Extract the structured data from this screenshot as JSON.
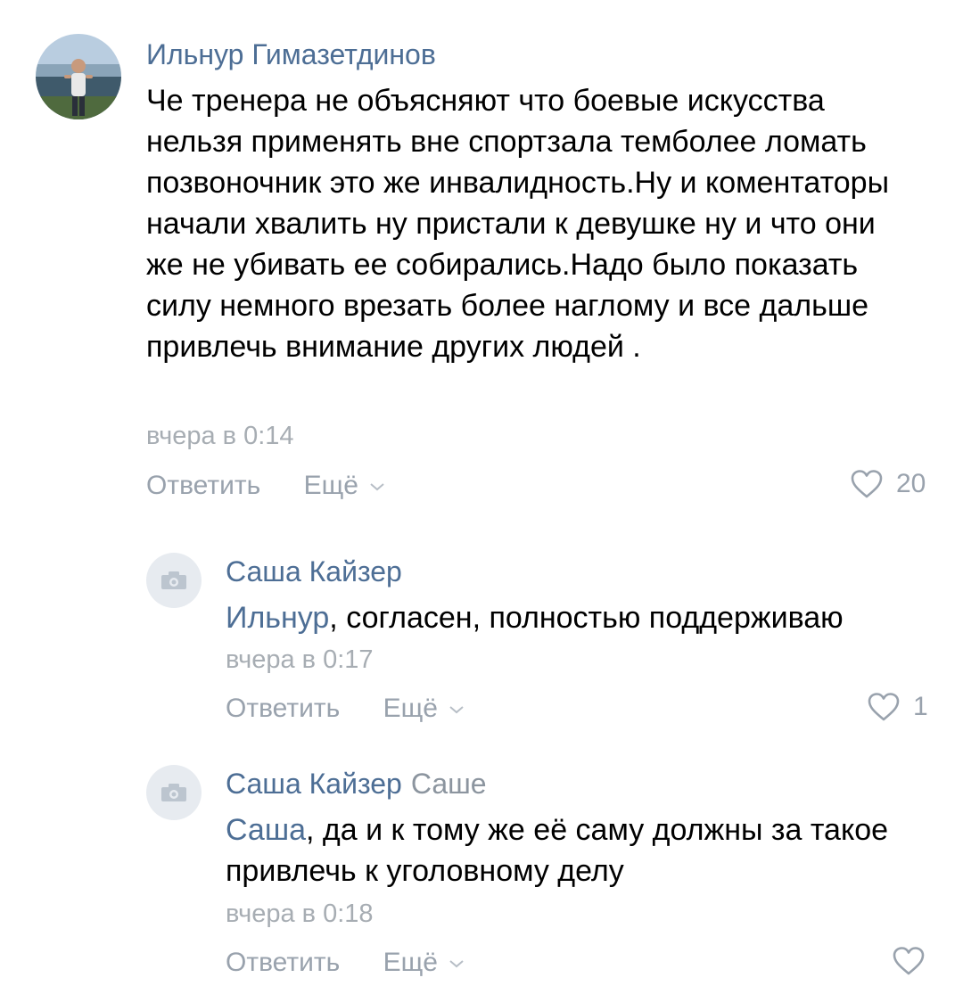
{
  "comments": [
    {
      "author": "Ильнур Гимазетдинов",
      "text": "Че тренера не объясняют что боевые искусства нельзя применять вне спортзала темболее ломать позвоночник это же инвалидность.Ну и коментаторы начали хвалить ну пристали к девушке ну и что они же не убивать ее собирались.Надо было показать силу немного врезать более наглому и все дальше привлечь внимание других людей .",
      "time": "вчера в 0:14",
      "reply_label": "Ответить",
      "more_label": "Ещё",
      "likes": "20"
    },
    {
      "author": "Саша Кайзер",
      "mention": "Ильнур",
      "text": ", согласен, полностью поддерживаю",
      "time": "вчера в 0:17",
      "reply_label": "Ответить",
      "more_label": "Ещё",
      "likes": "1"
    },
    {
      "author": "Саша Кайзер",
      "reply_to": "Саше",
      "mention": "Саша",
      "text": ", да и к тому же её саму должны за такое привлечь к уголовному делу",
      "time": "вчера в 0:18",
      "reply_label": "Ответить",
      "more_label": "Ещё",
      "likes": ""
    }
  ],
  "icons": {
    "like": "heart-icon",
    "more": "chevron-down-icon",
    "no_avatar": "camera-icon"
  },
  "colors": {
    "author": "#4d6e95",
    "muted": "#99a2ad",
    "avatar_placeholder": "#e7ebf0"
  }
}
